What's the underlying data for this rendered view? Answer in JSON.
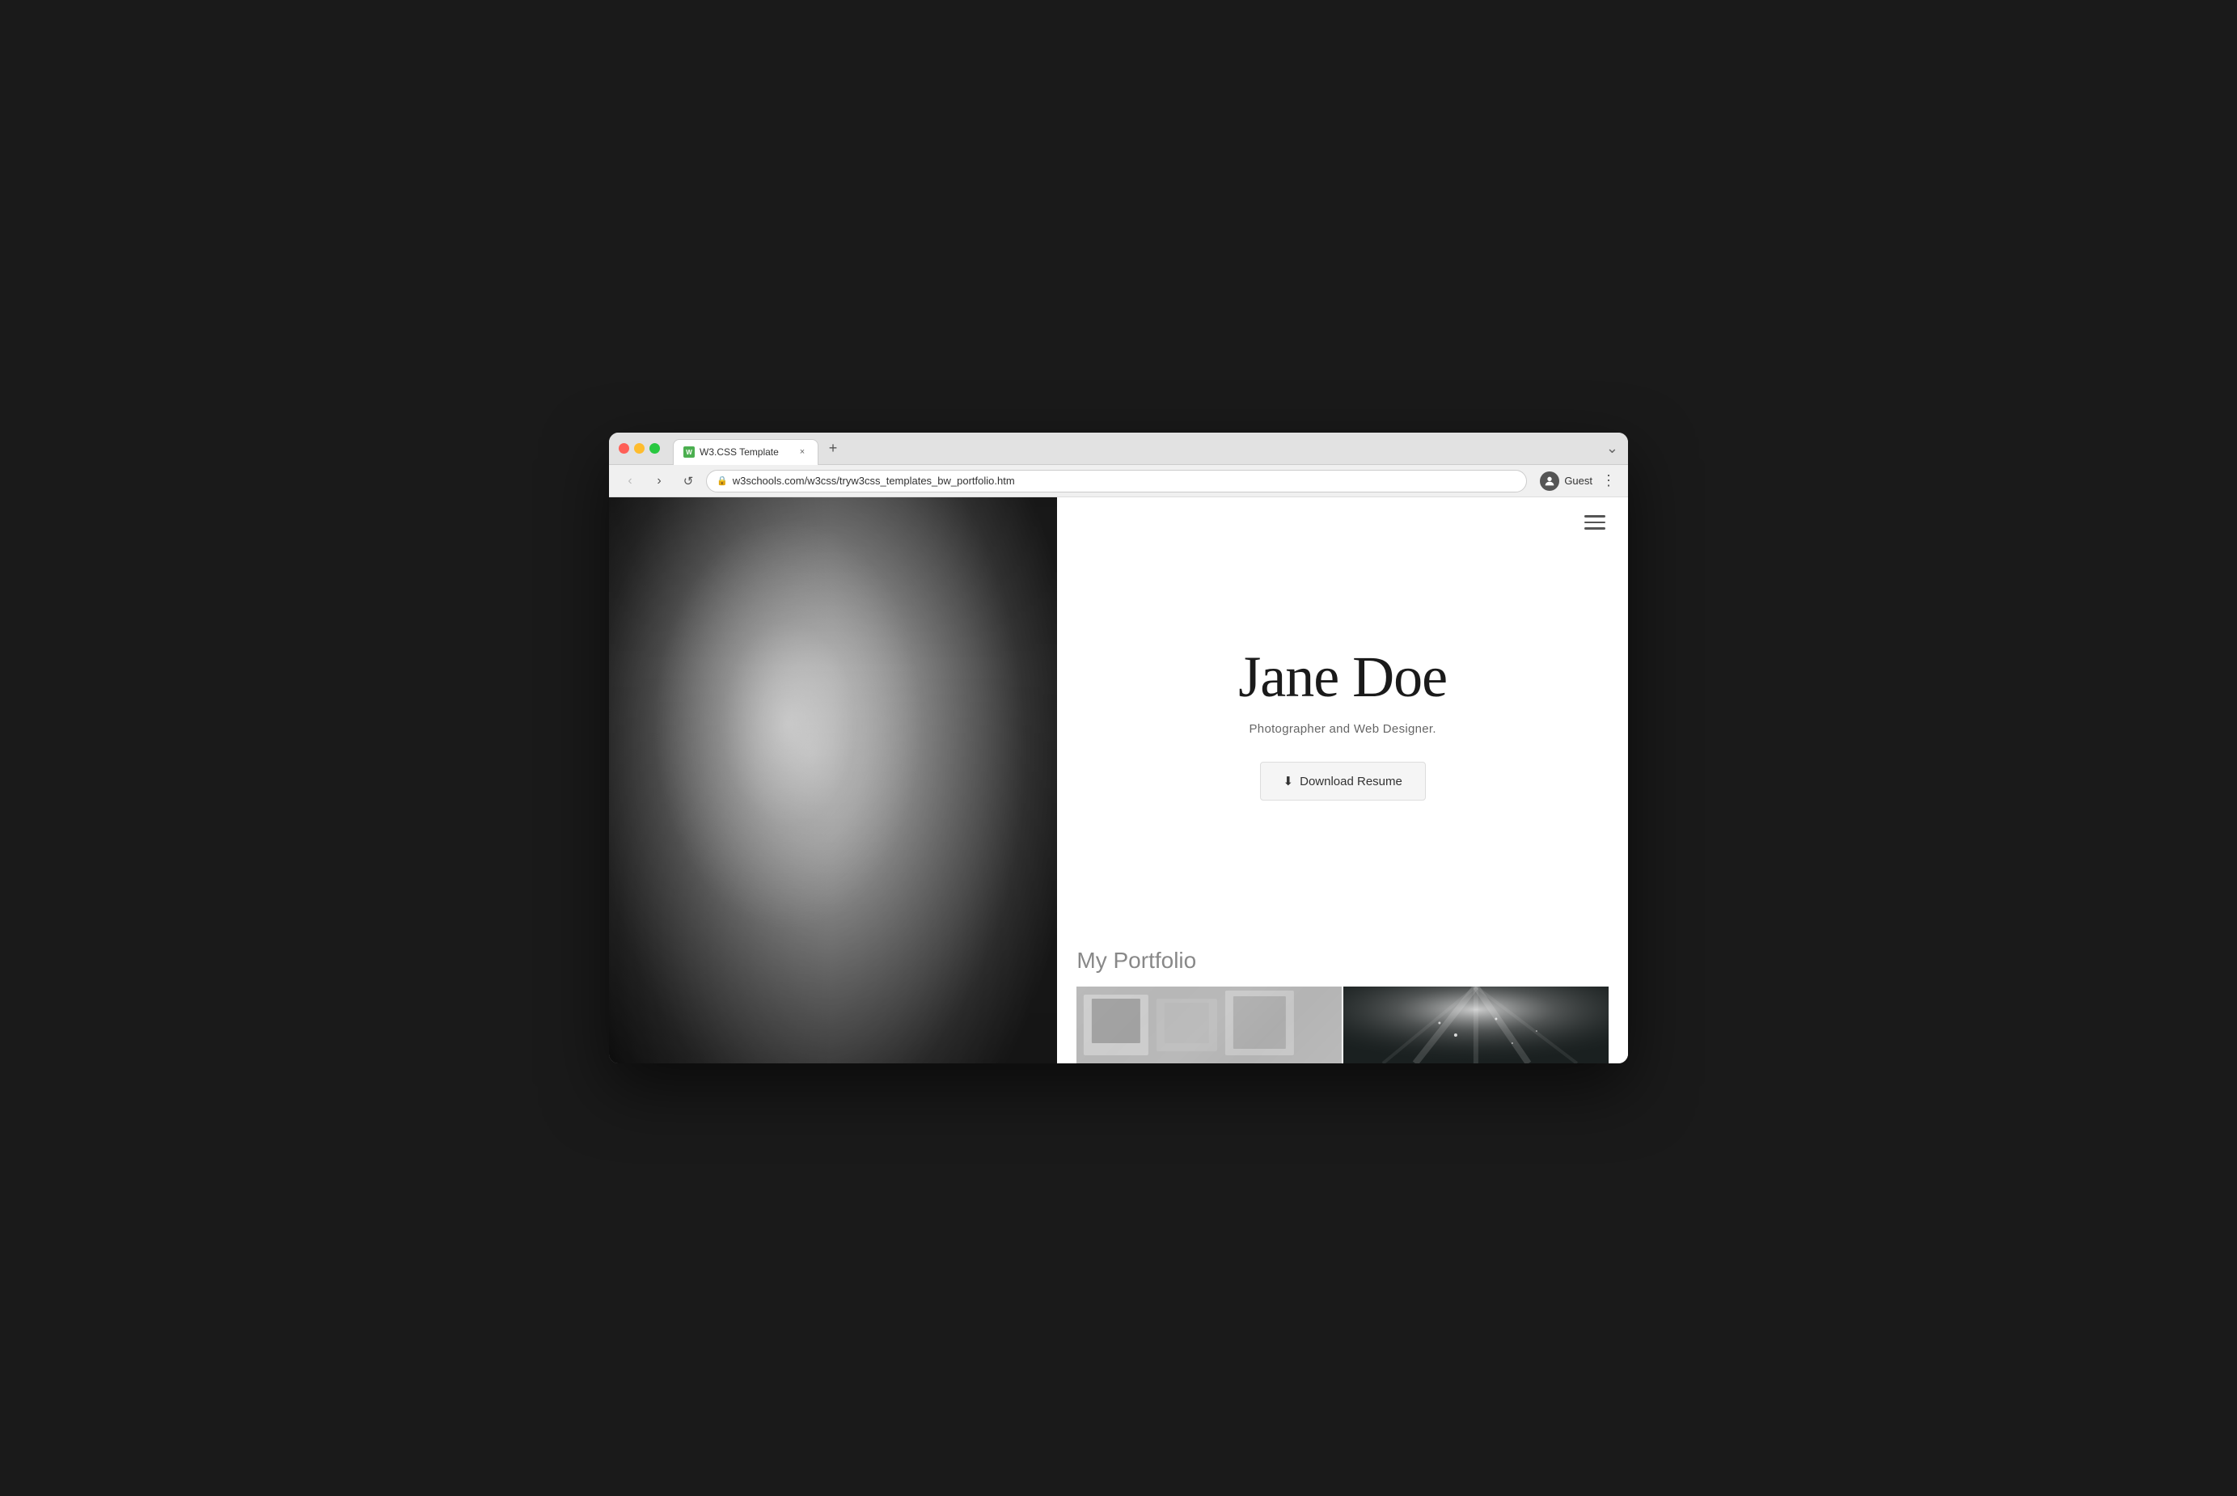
{
  "browser": {
    "tab_favicon": "W",
    "tab_title": "W3.CSS Template",
    "tab_close": "×",
    "tab_new": "+",
    "window_control_chevron": "⌄",
    "nav_back": "‹",
    "nav_forward": "›",
    "nav_refresh": "↺",
    "address_bar": {
      "lock_icon": "🔒",
      "url": "w3schools.com/w3css/tryw3css_templates_bw_portfolio.htm"
    },
    "profile": {
      "icon": "👤",
      "name": "Guest"
    },
    "more_icon": "⋮"
  },
  "website": {
    "hamburger_label": "menu",
    "hero": {
      "name": "Jane Doe",
      "subtitle": "Photographer and Web Designer.",
      "download_icon": "⬇",
      "download_label": "Download Resume"
    },
    "portfolio": {
      "heading": "My Portfolio"
    }
  }
}
